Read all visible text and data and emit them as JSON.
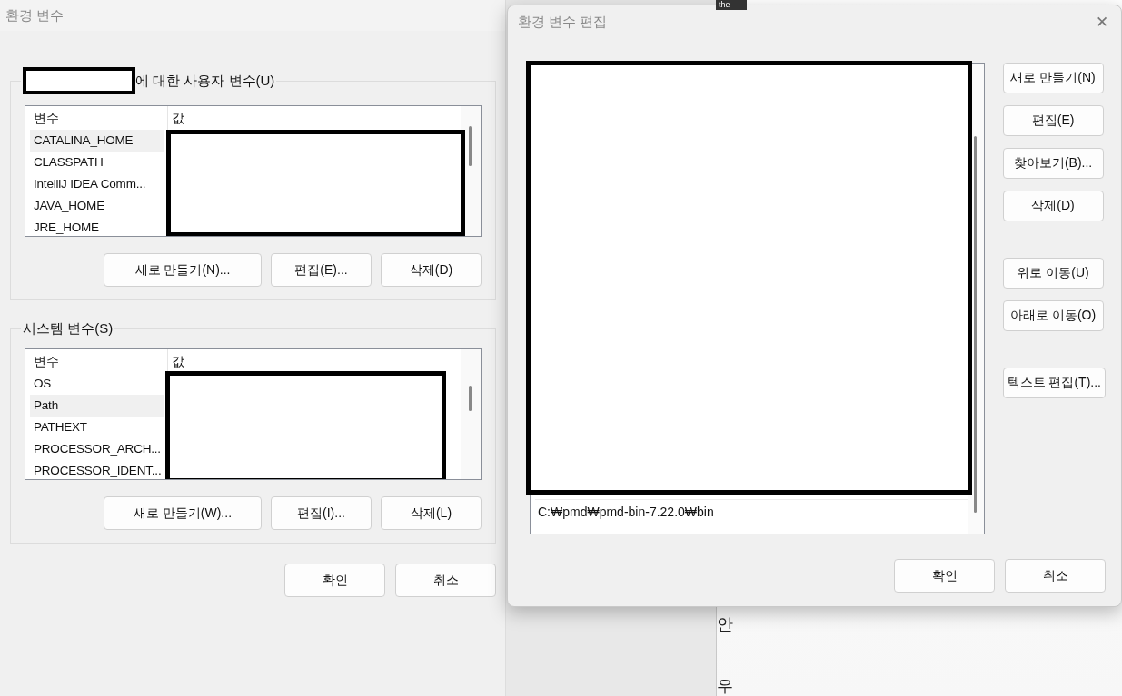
{
  "background_window": {
    "tab_label": "the",
    "texts": [
      "안",
      "우"
    ]
  },
  "main_dialog": {
    "title": "환경 변수",
    "groups": [
      {
        "legend": "에 대한 사용자 변수(U)",
        "has_redacted_name": true,
        "columns": [
          "변수",
          "값"
        ],
        "rows": [
          {
            "name": "CATALINA_HOME",
            "selected": true
          },
          {
            "name": "CLASSPATH",
            "selected": false
          },
          {
            "name": "IntelliJ IDEA Comm...",
            "selected": false
          },
          {
            "name": "JAVA_HOME",
            "selected": false
          },
          {
            "name": "JRE_HOME",
            "selected": false
          }
        ],
        "buttons": [
          "새로 만들기(N)...",
          "편집(E)...",
          "삭제(D)"
        ]
      },
      {
        "legend": "시스템 변수(S)",
        "has_redacted_name": false,
        "columns": [
          "변수",
          "값"
        ],
        "rows": [
          {
            "name": "OS",
            "selected": false
          },
          {
            "name": "Path",
            "selected": true
          },
          {
            "name": "PATHEXT",
            "selected": false
          },
          {
            "name": "PROCESSOR_ARCH...",
            "selected": false
          },
          {
            "name": "PROCESSOR_IDENT...",
            "selected": false
          }
        ],
        "buttons": [
          "새로 만들기(W)...",
          "편집(I)...",
          "삭제(L)"
        ]
      }
    ],
    "buttons": [
      "확인",
      "취소"
    ]
  },
  "edit_dialog": {
    "title": "환경 변수 편집",
    "close": "✕",
    "entries": [
      {
        "text": "C:₩pmd₩pmd-bin-7.22.0₩bin",
        "selected": false
      }
    ],
    "side_button_groups": [
      [
        "새로 만들기(N)",
        "편집(E)",
        "찾아보기(B)...",
        "삭제(D)"
      ],
      [
        "위로 이동(U)",
        "아래로 이동(O)"
      ],
      [
        "텍스트 편집(T)..."
      ]
    ],
    "buttons": [
      "확인",
      "취소"
    ]
  }
}
